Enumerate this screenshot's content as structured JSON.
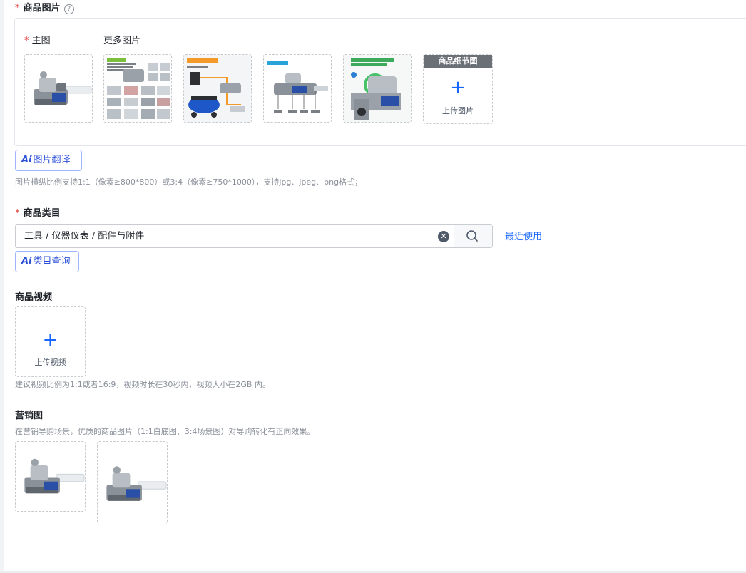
{
  "images_section": {
    "label": "商品图片",
    "help_icon": "question-circle-icon",
    "main_label": "主图",
    "more_label": "更多图片",
    "detail_header": "商品细节图",
    "upload_text": "上传图片",
    "thumb_count": 5,
    "ai_translate_badge": "Ai",
    "ai_translate_label": "图片翻译",
    "hint": "图片横纵比例支持1:1（像素≥800*800）或3:4（像素≥750*1000），支持jpg、jpeg、png格式；"
  },
  "category_section": {
    "label": "商品类目",
    "value": "工具 / 仪器仪表 / 配件与附件",
    "recent_link": "最近使用",
    "ai_query_badge": "Ai",
    "ai_query_label": "类目查询"
  },
  "video_section": {
    "label": "商品视频",
    "upload_text": "上传视频",
    "hint": "建议视频比例为1:1或者16:9，视频时长在30秒内，视频大小在2GB 内。"
  },
  "marketing_section": {
    "label": "营销图",
    "hint": "在营销导购场景，优质的商品图片（1:1白底图、3:4场景图）对导购转化有正向效果。"
  },
  "colors": {
    "required": "#e23c39",
    "accent": "#1966ff",
    "ai_blue": "#2b50d8"
  }
}
